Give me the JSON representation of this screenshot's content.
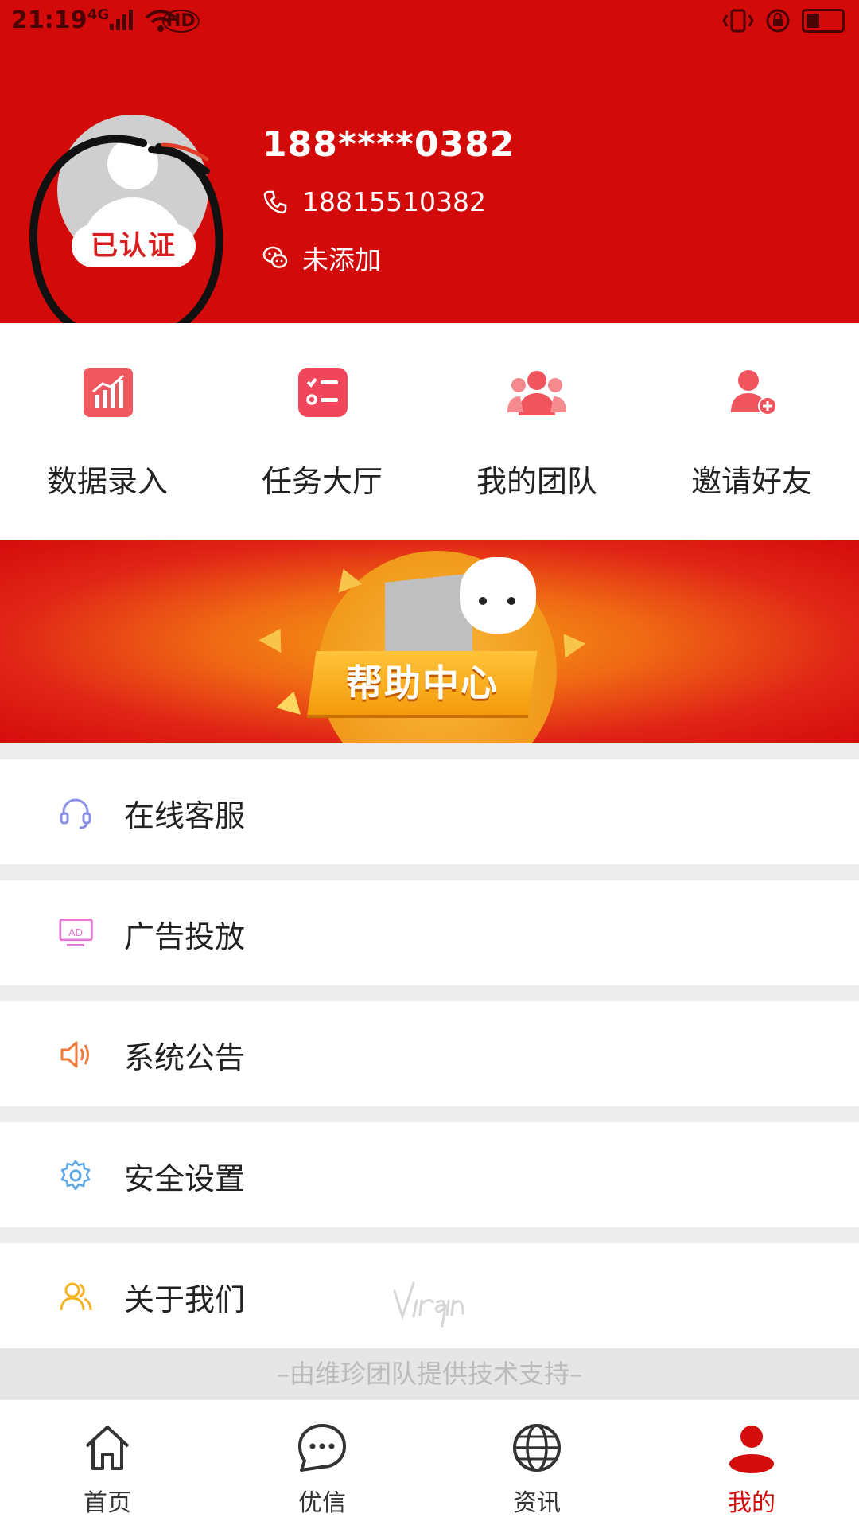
{
  "status_bar": {
    "time": "21:19",
    "network": "4G",
    "hd": "HD"
  },
  "profile": {
    "verified_badge": "已认证",
    "name": "188****0382",
    "phone": "18815510382",
    "wechat": "未添加"
  },
  "actions": [
    {
      "label": "数据录入",
      "icon": "chart-icon"
    },
    {
      "label": "任务大厅",
      "icon": "task-list-icon"
    },
    {
      "label": "我的团队",
      "icon": "team-icon"
    },
    {
      "label": "邀请好友",
      "icon": "add-user-icon"
    }
  ],
  "banner": {
    "title": "帮助中心"
  },
  "menu": [
    {
      "label": "在线客服",
      "icon": "headset-icon"
    },
    {
      "label": "广告投放",
      "icon": "ad-icon"
    },
    {
      "label": "系统公告",
      "icon": "speaker-icon"
    },
    {
      "label": "安全设置",
      "icon": "gear-icon"
    },
    {
      "label": "关于我们",
      "icon": "users-icon"
    }
  ],
  "footer": {
    "note": "–由维珍团队提供技术支持–"
  },
  "nav": [
    {
      "label": "首页",
      "icon": "home-icon"
    },
    {
      "label": "优信",
      "icon": "chat-icon"
    },
    {
      "label": "资讯",
      "icon": "globe-icon"
    },
    {
      "label": "我的",
      "icon": "person-icon",
      "active": true
    }
  ],
  "colors": {
    "brand_red": "#d20a0a",
    "active_nav": "#d50c0c"
  }
}
